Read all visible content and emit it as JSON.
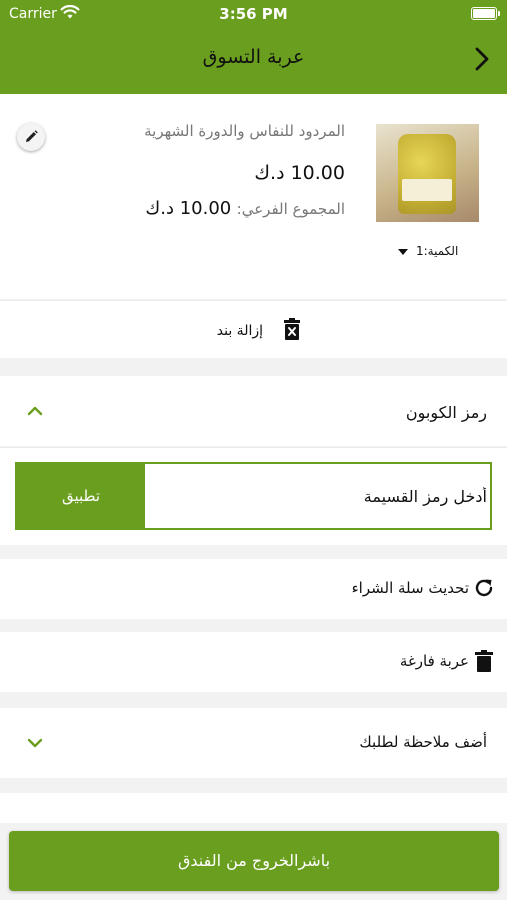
{
  "status_bar": {
    "carrier": "Carrier",
    "time": "3:56 PM"
  },
  "nav": {
    "title": "عربة التسوق",
    "back_icon": "chevron-right-icon"
  },
  "cart_item": {
    "name": "المردود للنفاس والدورة الشهرية",
    "price": "10.00 د.ك",
    "subtotal_label": "المجموع الفرعي:",
    "subtotal_value": "10.00 د.ك",
    "quantity_label": "الكمية:1",
    "edit_icon": "pencil-icon",
    "remove_label": "إزالة بند",
    "remove_icon": "trash-x-icon"
  },
  "coupon": {
    "title": "رمز الكوبون",
    "placeholder": "أدخل رمز القسيمة",
    "apply_label": "تطبيق"
  },
  "actions": {
    "update_label": "تحديث سلة الشراء",
    "update_icon": "refresh-icon",
    "empty_label": "عربة فارغة",
    "empty_icon": "trash-icon",
    "note_label": "أضف ملاحظة لطلبك"
  },
  "checkout": {
    "label": "باشرالخروج من الفندق"
  },
  "colors": {
    "accent": "#6a9e1f",
    "background": "#f2f2f2"
  }
}
